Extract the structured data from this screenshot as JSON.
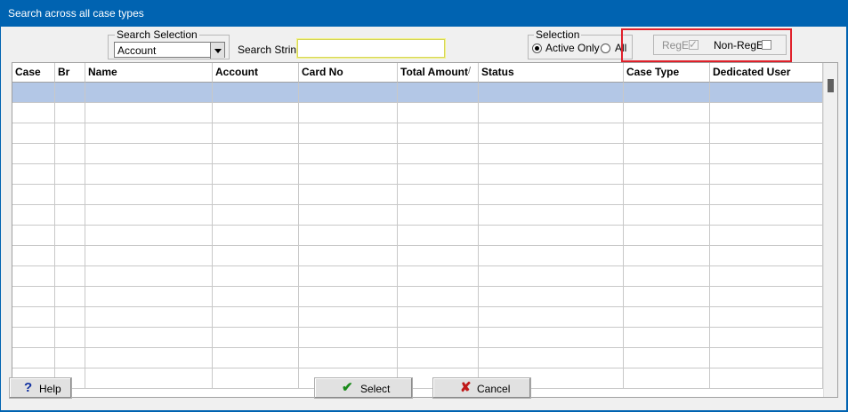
{
  "window": {
    "title": "Search across all case types"
  },
  "search": {
    "selection_legend": "Search Selection",
    "selection_value": "Account",
    "string_label": "Search String",
    "string_value": ""
  },
  "selection": {
    "legend": "Selection",
    "active_only": "Active Only",
    "all": "All",
    "selected": "Active Only"
  },
  "filters": {
    "rege_label": "RegE",
    "rege_checked": true,
    "nonrege_label": "Non-RegE",
    "nonrege_checked": false
  },
  "table": {
    "columns": [
      "Case",
      "Br",
      "Name",
      "Account",
      "Card No",
      "Total Amount",
      "Status",
      "Case Type",
      "Dedicated User"
    ],
    "sort_indicator": "/",
    "rows": []
  },
  "buttons": {
    "help": "Help",
    "select": "Select",
    "cancel": "Cancel"
  },
  "icons": {
    "help": "question-mark",
    "select": "check-mark",
    "cancel": "x-mark"
  },
  "colors": {
    "titlebar": "#0063b1",
    "row_selected": "#b3c7e6",
    "highlight_box": "#e0202a",
    "select_icon": "#1a8a1a",
    "cancel_icon": "#c01818",
    "help_icon": "#1030a0"
  }
}
